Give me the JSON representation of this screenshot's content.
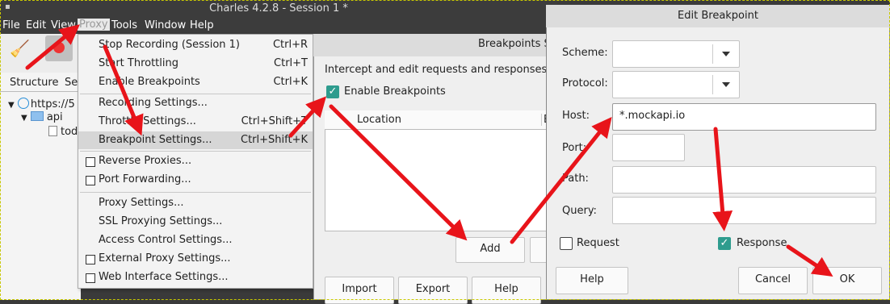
{
  "main_window": {
    "title": "Charles 4.2.8 - Session 1 *",
    "menu": [
      "File",
      "Edit",
      "View",
      "Proxy",
      "Tools",
      "Window",
      "Help"
    ],
    "tabs": [
      "Structure",
      "Se"
    ],
    "tree": [
      {
        "label": "https://5",
        "icon": "globe-icon"
      },
      {
        "label": "api",
        "icon": "folder-icon"
      },
      {
        "label": "tod",
        "icon": "file-icon"
      }
    ]
  },
  "proxy_menu": {
    "items": [
      {
        "label": "Stop Recording (Session 1)",
        "accel": "Ctrl+R"
      },
      {
        "label": "Start Throttling",
        "accel": "Ctrl+T"
      },
      {
        "label": "Enable Breakpoints",
        "accel": "Ctrl+K"
      },
      {
        "label": "Recording Settings...",
        "accel": ""
      },
      {
        "label": "Throttle Settings...",
        "accel": "Ctrl+Shift+T"
      },
      {
        "label": "Breakpoint Settings...",
        "accel": "Ctrl+Shift+K"
      },
      {
        "label": "Reverse Proxies...",
        "accel": ""
      },
      {
        "label": "Port Forwarding...",
        "accel": ""
      },
      {
        "label": "Proxy Settings...",
        "accel": ""
      },
      {
        "label": "SSL Proxying Settings...",
        "accel": ""
      },
      {
        "label": "Access Control Settings...",
        "accel": ""
      },
      {
        "label": "External Proxy Settings...",
        "accel": ""
      },
      {
        "label": "Web Interface Settings...",
        "accel": ""
      }
    ]
  },
  "breakpoints_dialog": {
    "title": "Breakpoints Se",
    "description": "Intercept and edit requests and responses befor",
    "enable_label": "Enable Breakpoints",
    "enable_checked": true,
    "column_location": "Location",
    "column_b": "B",
    "add_label": "Add",
    "import_label": "Import",
    "export_label": "Export",
    "help_label": "Help"
  },
  "edit_breakpoint": {
    "title": "Edit Breakpoint",
    "scheme_label": "Scheme:",
    "protocol_label": "Protocol:",
    "host_label": "Host:",
    "host_value": "*.mockapi.io",
    "port_label": "Port:",
    "path_label": "Path:",
    "query_label": "Query:",
    "request_label": "Request",
    "request_checked": false,
    "response_label": "Response",
    "response_checked": true,
    "help_label": "Help",
    "cancel_label": "Cancel",
    "ok_label": "OK"
  },
  "colors": {
    "annotation_arrow": "#e8141a",
    "checkbox_checked": "#2e9c8e",
    "menu_highlight": "#d6d6d6"
  }
}
